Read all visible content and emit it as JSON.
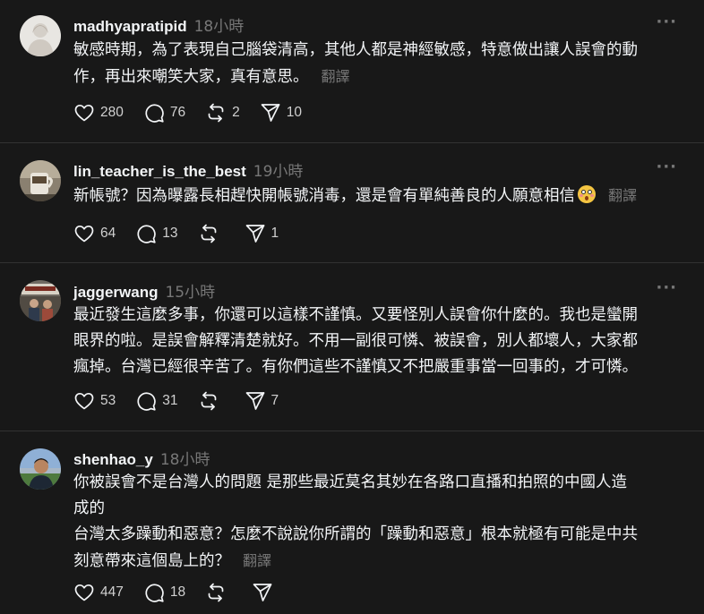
{
  "more_label": "···",
  "translate_label": "翻譯",
  "posts": [
    {
      "username": "madhyapratipid",
      "time": "18小時",
      "lines": [
        "敏感時期，為了表現自己腦袋清高，其他人都是神經敏感，特意做出讓人誤會的動",
        "作，再出來嘲笑大家，真有意思。"
      ],
      "likes": "280",
      "replies": "76",
      "reposts": "2",
      "shares": "10"
    },
    {
      "username": "lin_teacher_is_the_best",
      "time": "19小時",
      "lines": [
        "新帳號？因為曝露長相趕快開帳號消毒，還是會有單純善良的人願意相信"
      ],
      "likes": "64",
      "replies": "13",
      "reposts": "",
      "shares": "1"
    },
    {
      "username": "jaggerwang",
      "time": "15小時",
      "lines": [
        "最近發生這麼多事，你還可以這樣不謹慎。又要怪別人誤會你什麼的。我也是蠻開",
        "眼界的啦。是誤會解釋清楚就好。不用一副很可憐、被誤會，別人都壞人，大家都",
        "瘋掉。台灣已經很辛苦了。有你們這些不謹慎又不把嚴重事當一回事的，才可憐。"
      ],
      "likes": "53",
      "replies": "31",
      "reposts": "",
      "shares": "7"
    },
    {
      "username": "shenhao_y",
      "time": "18小時",
      "lines": [
        "你被誤會不是台灣人的問題 是那些最近莫名其妙在各路口直播和拍照的中國人造",
        "成的",
        "台灣太多躁動和惡意？怎麼不說說你所謂的「躁動和惡意」根本就極有可能是中共",
        "刻意帶來這個島上的？"
      ],
      "likes": "447",
      "replies": "18",
      "reposts": "",
      "shares": ""
    }
  ],
  "colors": {
    "background": "#181818",
    "text": "#f3f5f7",
    "muted": "#777777",
    "divider": "#323232"
  },
  "icons": [
    "heart-icon",
    "comment-icon",
    "repost-icon",
    "share-icon",
    "more-icon"
  ]
}
